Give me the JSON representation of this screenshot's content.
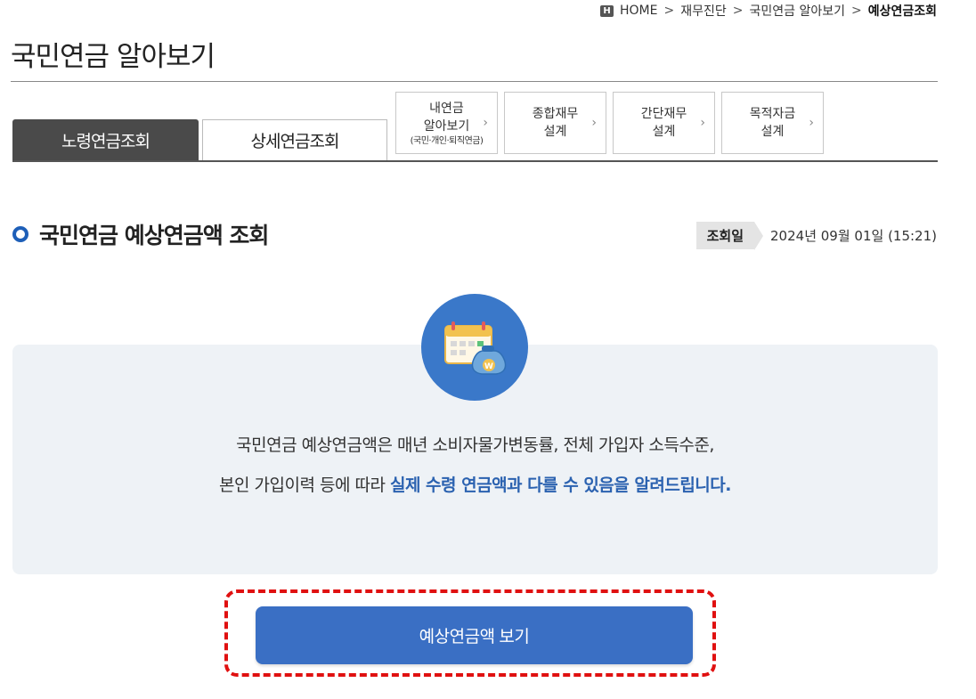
{
  "breadcrumb": {
    "home_label": "HOME",
    "items": [
      "재무진단",
      "국민연금 알아보기"
    ],
    "current": "예상연금조회"
  },
  "page_title": "국민연금 알아보기",
  "tabs": [
    {
      "label": "노령연금조회",
      "active": true
    },
    {
      "label": "상세연금조회",
      "active": false
    }
  ],
  "sub_buttons": [
    {
      "lines": [
        "내연금",
        "알아보기"
      ],
      "note": "(국민·개인·퇴직연금)"
    },
    {
      "lines": [
        "종합재무",
        "설계"
      ],
      "note": ""
    },
    {
      "lines": [
        "간단재무",
        "설계"
      ],
      "note": ""
    },
    {
      "lines": [
        "목적자금",
        "설계"
      ],
      "note": ""
    }
  ],
  "section": {
    "title": "국민연금 예상연금액 조회",
    "date_label": "조회일",
    "date_value": "2024년 09월 01일 (15:21)"
  },
  "info": {
    "line1": "국민연금 예상연금액은 매년 소비자물가변동률, 전체 가입자 소득수준,",
    "line2_prefix": "본인 가입이력 등에 따라 ",
    "line2_highlight": "실제 수령 연금액과 다를 수 있음을 알려드립니다."
  },
  "primary_button": "예상연금액 보기",
  "icons": {
    "home": "home-icon",
    "chevron": "chevron-right-icon",
    "calendar_money": "calendar-money-icon",
    "bullet": "ring-bullet-icon"
  },
  "colors": {
    "accent": "#3a6fc4",
    "highlight_text": "#2b62b0",
    "info_bg": "#eef2f6",
    "active_tab": "#4a4a4a",
    "emphasis_frame": "#e01010"
  }
}
